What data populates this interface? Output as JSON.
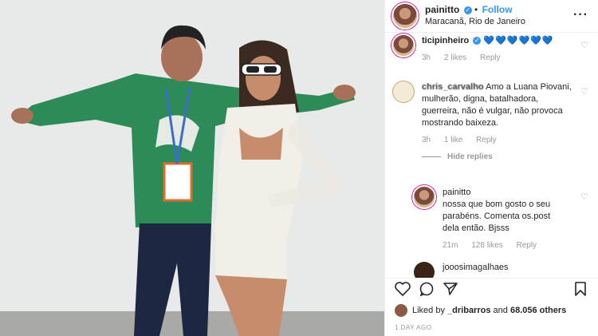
{
  "header": {
    "username": "painitto",
    "follow_label": "Follow",
    "location": "Maracanã, Rio de Janeiro"
  },
  "comments": [
    {
      "username": "ticipinheiro",
      "text": "💙💙💙💙💙💙",
      "time": "3h",
      "likes": "2 likes",
      "reply": "Reply"
    },
    {
      "username": "chris_carvalho",
      "text": "Amo a Luana Piovani, mulherão, digna, batalhadora, guerreira, não é vulgar, não provoca mostrando baixeza.",
      "time": "3h",
      "likes": "1 like",
      "reply": "Reply",
      "hide_replies": "Hide replies"
    },
    {
      "username": "painitto",
      "text": "nossa que bom gosto o seu parabéns. Comenta os.post dela então. Bjsss",
      "time": "21m",
      "likes": "128 likes",
      "reply": "Reply"
    },
    {
      "username": "jooosimagalhaes"
    }
  ],
  "likes": {
    "prefix": "Liked by",
    "user": "_dribarros",
    "middle": "and",
    "count": "68.056 others"
  },
  "time_ago": "1 DAY AGO",
  "icons": [
    "verified-icon",
    "more-icon",
    "heart-icon",
    "comment-icon",
    "share-icon",
    "bookmark-icon"
  ],
  "colors": {
    "accent": "#3897f0",
    "muted": "#999999"
  }
}
